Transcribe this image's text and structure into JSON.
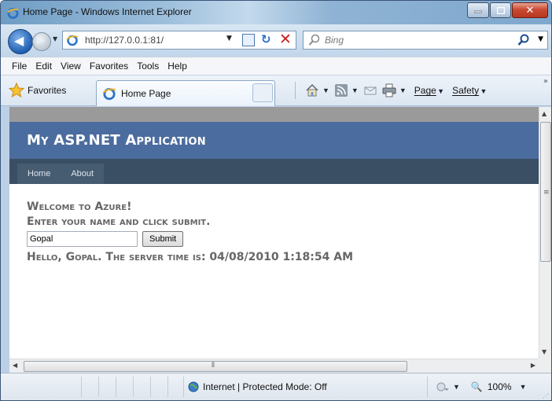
{
  "window": {
    "title": "Home Page - Windows Internet Explorer"
  },
  "address_bar": {
    "url": "http://127.0.0.1:81/",
    "search_placeholder": "Bing"
  },
  "menu": [
    "File",
    "Edit",
    "View",
    "Favorites",
    "Tools",
    "Help"
  ],
  "favorites_bar": {
    "favorites_label": "Favorites",
    "tab_title": "Home Page",
    "page_label": "Page",
    "safety_label": "Safety"
  },
  "site": {
    "title": "My ASP.NET Application",
    "nav": [
      "Home",
      "About"
    ],
    "welcome": "Welcome to Azure!",
    "instruction": "Enter your name and click submit.",
    "name_value": "Gopal",
    "submit_label": "Submit",
    "result": "Hello, Gopal. The server time is: 04/08/2010 1:18:54 AM"
  },
  "status_bar": {
    "zone": "Internet | Protected Mode: Off",
    "zoom": "100%"
  },
  "colors": {
    "site_header": "#4b6c9e",
    "site_nav": "#3a4f63",
    "site_menu": "#465c71",
    "heading_text": "#666666"
  }
}
